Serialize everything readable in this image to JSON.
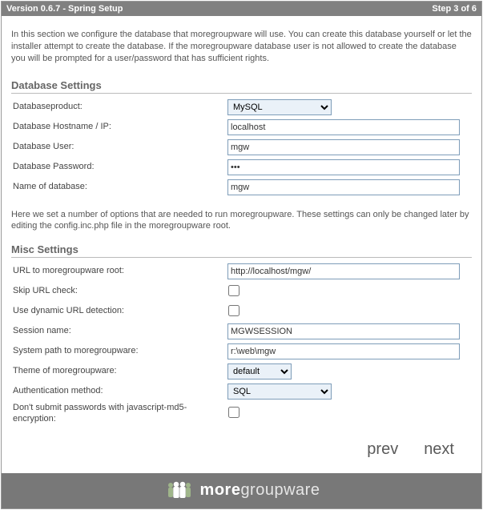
{
  "titlebar": {
    "left": "Version 0.6.7 - Spring Setup",
    "right": "Step 3 of 6"
  },
  "intro": "In this section we configure the database that moregroupware will use. You can create this database yourself or let the installer attempt to create the database. If the moregroupware database user is not allowed to create the database you will be prompted for a user/password that has sufficient rights.",
  "db": {
    "heading": "Database Settings",
    "product_label": "Databaseproduct:",
    "product_value": "MySQL",
    "host_label": "Database Hostname / IP:",
    "host_value": "localhost",
    "user_label": "Database User:",
    "user_value": "mgw",
    "pass_label": "Database Password:",
    "pass_value": "•••",
    "name_label": "Name of database:",
    "name_value": "mgw"
  },
  "misc_intro": "Here we set a number of options that are needed to run moregroupware. These settings can only be changed later by editing the config.inc.php file in the moregroupware root.",
  "misc": {
    "heading": "Misc Settings",
    "url_label": "URL to moregroupware root:",
    "url_value": "http://localhost/mgw/",
    "skip_label": "Skip URL check:",
    "dyn_label": "Use dynamic URL detection:",
    "session_label": "Session name:",
    "session_value": "MGWSESSION",
    "path_label": "System path to moregroupware:",
    "path_value": "r:\\web\\mgw",
    "theme_label": "Theme of moregroupware:",
    "theme_value": "default",
    "auth_label": "Authentication method:",
    "auth_value": "SQL",
    "md5_label": "Don't submit passwords with javascript-md5-encryption:"
  },
  "nav": {
    "prev": "prev",
    "next": "next"
  },
  "footer": {
    "bold": "more",
    "light": "groupware"
  }
}
